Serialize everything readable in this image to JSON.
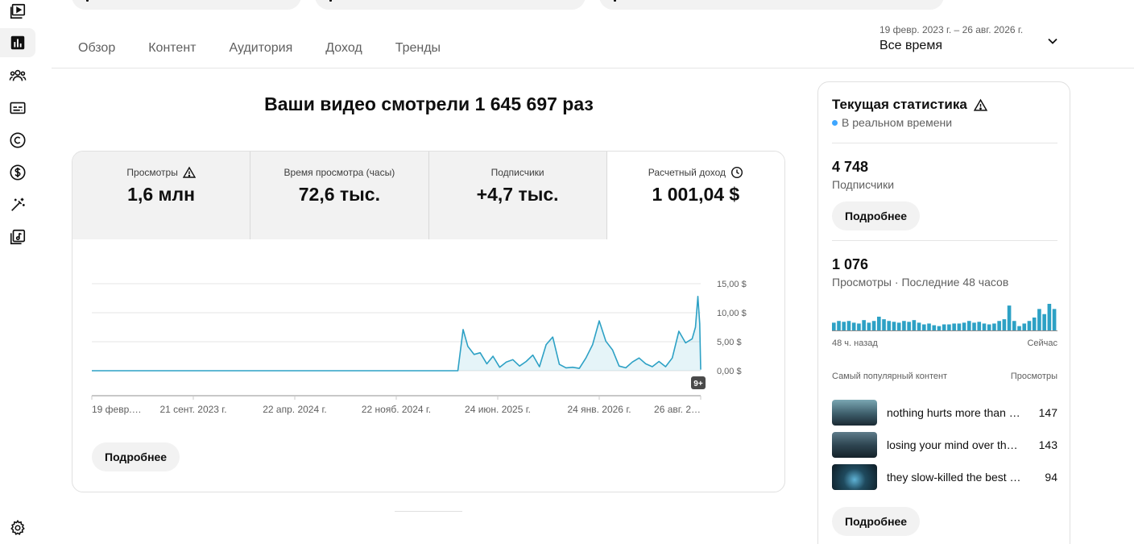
{
  "tabs": [
    {
      "label": "Обзор",
      "active": true
    },
    {
      "label": "Контент",
      "active": false
    },
    {
      "label": "Аудитория",
      "active": false
    },
    {
      "label": "Доход",
      "active": false
    },
    {
      "label": "Тренды",
      "active": false
    }
  ],
  "date_range": {
    "dates": "19 февр. 2023 г. – 26 авг. 2026 г.",
    "label": "Все время"
  },
  "headline": "Ваши видео смотрели 1 645 697 раз",
  "metrics": [
    {
      "label": "Просмотры",
      "value": "1,6 млн",
      "icon": "warning-icon"
    },
    {
      "label": "Время просмотра (часы)",
      "value": "72,6 тыс."
    },
    {
      "label": "Подписчики",
      "value": "+4,7 тыс."
    },
    {
      "label": "Расчетный доход",
      "value": "1 001,04 $",
      "icon": "clock-icon",
      "active": true
    }
  ],
  "chart_data": {
    "type": "line",
    "x_ticks": [
      "19 февр.…",
      "21 сент. 2023 г.",
      "22 апр. 2024 г.",
      "22 нояб. 2024 г.",
      "24 июн. 2025 г.",
      "24 янв. 2026 г.",
      "26 авг. 2…"
    ],
    "y_ticks": [
      "0,00 $",
      "5,00 $",
      "10,00 $",
      "15,00 $"
    ],
    "ylim": [
      0,
      15
    ],
    "x_range": [
      "2023-02-19",
      "2026-08-26"
    ],
    "badge": "9+",
    "color": "#2da1c5",
    "series": [
      {
        "x": [
          "2023-02-19",
          "2025-04-01",
          "2025-04-12",
          "2025-04-22",
          "2025-05-05",
          "2025-05-18",
          "2025-06-01",
          "2025-06-14",
          "2025-06-28",
          "2025-07-12",
          "2025-07-26",
          "2025-08-09",
          "2025-08-23",
          "2025-09-06",
          "2025-09-20",
          "2025-10-04",
          "2025-10-18",
          "2025-11-01",
          "2025-11-15",
          "2025-11-29",
          "2025-12-13",
          "2025-12-27",
          "2026-01-10",
          "2026-01-24",
          "2026-02-07",
          "2026-02-21",
          "2026-03-07",
          "2026-03-21",
          "2026-04-04",
          "2026-04-18",
          "2026-05-02",
          "2026-05-16",
          "2026-05-30",
          "2026-06-13",
          "2026-06-27",
          "2026-07-11",
          "2026-07-25",
          "2026-08-08",
          "2026-08-15",
          "2026-08-20",
          "2026-08-24",
          "2026-08-26"
        ],
        "y": [
          0,
          0,
          7.1,
          4.2,
          2.8,
          3.1,
          1.2,
          2.5,
          0.6,
          1.5,
          1.9,
          0.8,
          1.6,
          2.7,
          0.7,
          4.5,
          5.8,
          1.1,
          0.5,
          0.6,
          0.4,
          2.2,
          4.5,
          8.6,
          5.1,
          3.6,
          0.8,
          0.5,
          1.5,
          2.2,
          1.2,
          0.7,
          1.6,
          0.7,
          2.2,
          6.8,
          4.8,
          5.5,
          7.5,
          12.8,
          8.1,
          0.2
        ]
      }
    ]
  },
  "card_more": "Подробнее",
  "panel": {
    "title": "Текущая статистика",
    "realtime": "В реальном времени",
    "subs_value": "4 748",
    "subs_label": "Подписчики",
    "more1": "Подробнее",
    "views_value": "1 076",
    "views_label": "Просмотры · Последние 48 часов",
    "bars": [
      10,
      12,
      11,
      12,
      10,
      9,
      13,
      10,
      12,
      17,
      14,
      12,
      11,
      10,
      12,
      11,
      13,
      10,
      8,
      9,
      7,
      6,
      8,
      8,
      9,
      9,
      10,
      12,
      10,
      11,
      9,
      8,
      9,
      12,
      14,
      30,
      12,
      6,
      9,
      12,
      16,
      26,
      20,
      32,
      26
    ],
    "axis_left": "48 ч. назад",
    "axis_right": "Сейчас",
    "top_label": "Самый популярный контент",
    "top_metric": "Просмотры",
    "items": [
      {
        "title": "nothing hurts more than …",
        "views": "147"
      },
      {
        "title": "losing your mind over th…",
        "views": "143"
      },
      {
        "title": "they slow-killed the best p…",
        "views": "94"
      }
    ],
    "more2": "Подробнее"
  }
}
